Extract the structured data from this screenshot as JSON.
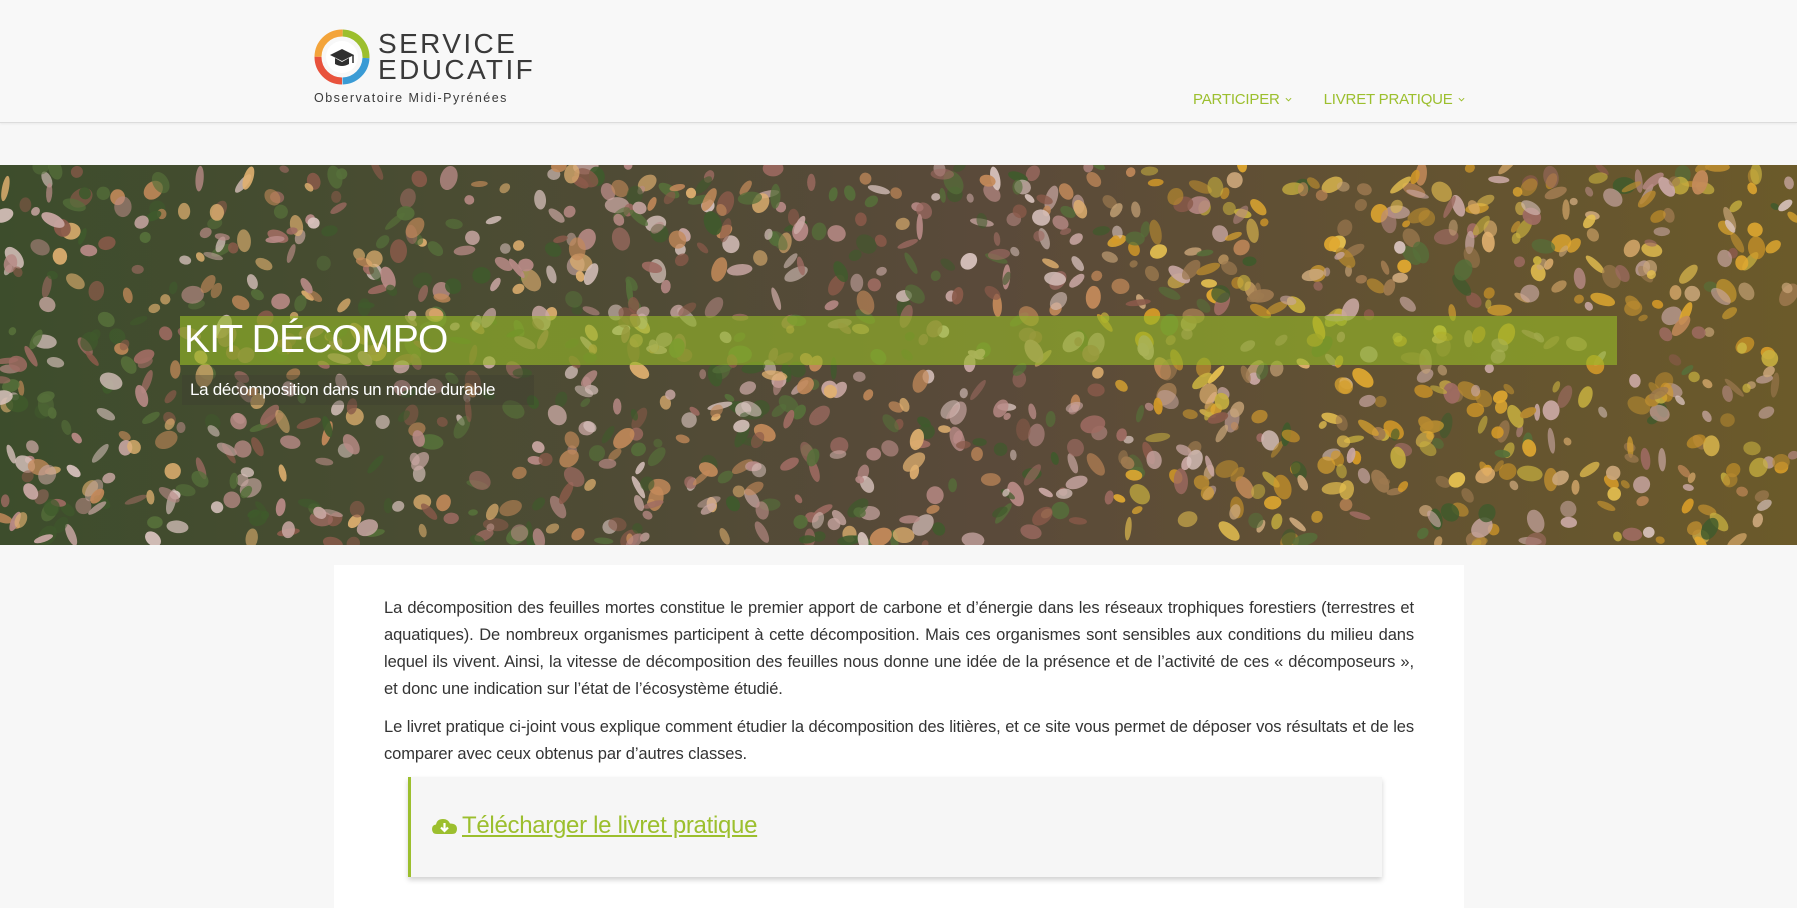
{
  "header": {
    "logo": {
      "line1": "SERVICE",
      "line2": "EDUCATIF",
      "subtitle": "Observatoire Midi-Pyrénées",
      "icon": "graduation-cap-icon"
    },
    "nav": [
      {
        "label": "PARTICIPER",
        "icon": "chevron-down-icon"
      },
      {
        "label": "LIVRET PRATIQUE",
        "icon": "chevron-down-icon"
      }
    ]
  },
  "hero": {
    "title": "KIT DÉCOMPO",
    "subtitle": "La décomposition dans un monde durable"
  },
  "content": {
    "paragraphs": [
      "La décomposition des feuilles mortes constitue le premier apport de carbone et d’énergie dans les réseaux trophiques forestiers (terrestres et aquatiques). De nombreux organismes participent à cette décomposition. Mais ces organismes sont sensibles aux conditions du milieu dans lequel ils vivent. Ainsi, la vitesse de décomposition des feuilles nous donne une idée de la présence et de l’activité de ces « décomposeurs », et donc une indication sur l’état de l’écosystème étudié.",
      "Le livret pratique ci-joint vous explique comment étudier la décomposition des litières, et ce site vous permet de déposer vos résultats et de les comparer avec ceux obtenus par d’autres classes."
    ],
    "download": {
      "label": " Télécharger le livret pratique",
      "icon": "cloud-download-icon"
    }
  },
  "colors": {
    "accent": "#9cbf2e",
    "text": "#333333",
    "background": "#f7f7f7"
  }
}
